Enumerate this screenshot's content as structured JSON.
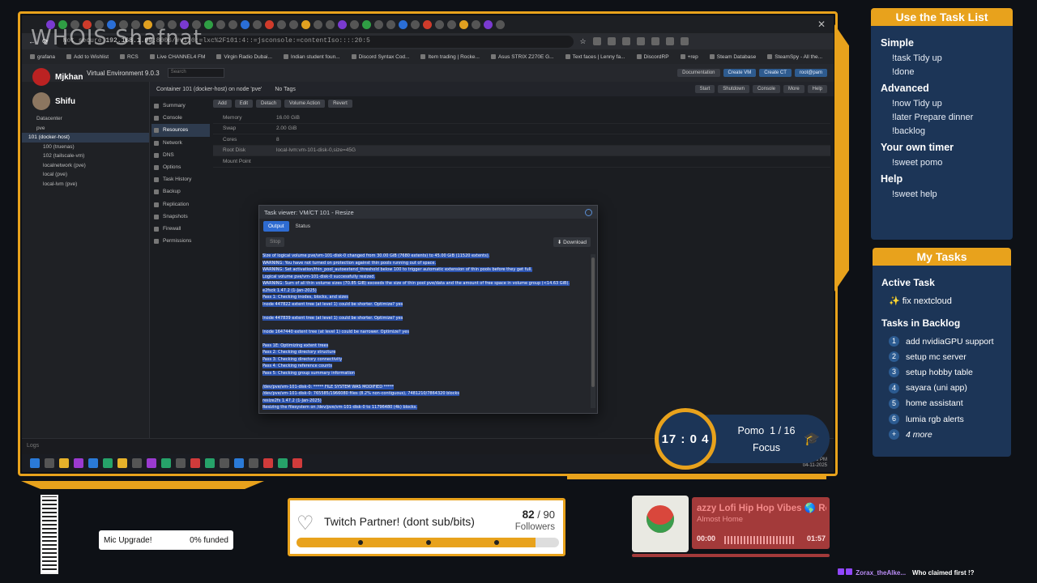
{
  "screen": {
    "address": {
      "prefix": "Not secure ",
      "host": "192.168.1.99",
      "rest": ":8006/#v1:0:=lxc%2F101:4::=jsconsole:=contentIso::::20:5"
    },
    "bookmarks": [
      "grafana",
      "Add to Wishlist",
      "RCS",
      "Live CHANNEL4 FM",
      "Virgin Radio Dubai...",
      "Indian student foun...",
      "Discord Syntax Cod...",
      "Item trading | Rocke...",
      "Asus STRIX Z270E G...",
      "Text faces | Lenny fa...",
      "DiscordRP",
      "+rep",
      "Steam Database",
      "SteamSpy - All the..."
    ],
    "pve": {
      "title": "Virtual Environment 9.0.3",
      "search_placeholder": "Search",
      "top_buttons": [
        "Documentation",
        "Create VM",
        "Create CT",
        "root@pam"
      ],
      "tree": [
        "Datacenter",
        "pve",
        "101 (docker-host)",
        "100 (truenas)",
        "102 (tailscale-vm)",
        "localnetwork (pve)",
        "local (pve)",
        "local-lvm (pve)"
      ],
      "container_title": "Container 101 (docker-host) on node 'pve'",
      "tags": "No Tags",
      "ct_buttons": [
        "Start",
        "Shutdown",
        "Console",
        "More",
        "Help"
      ],
      "menu": [
        "Summary",
        "Console",
        "Resources",
        "Network",
        "DNS",
        "Options",
        "Task History",
        "Backup",
        "Replication",
        "Snapshots",
        "Firewall",
        "Permissions"
      ],
      "toolbar": [
        "Add",
        "Edit",
        "Detach",
        "Volume Action",
        "Revert"
      ],
      "resources": [
        {
          "k": "Memory",
          "v": "16.00 GiB"
        },
        {
          "k": "Swap",
          "v": "2.00 GiB"
        },
        {
          "k": "Cores",
          "v": "8"
        },
        {
          "k": "Root Disk",
          "v": "local-lvm:vm-101-disk-0,size=45G"
        },
        {
          "k": "Mount Point",
          "v": ""
        }
      ],
      "log_label": "Logs"
    },
    "dialog": {
      "title": "Task viewer: VM/CT 101 - Resize",
      "tabs": [
        "Output",
        "Status"
      ],
      "stop": "Stop",
      "download": "Download",
      "lines": [
        "  Size of logical volume pve/vm-101-disk-0 changed from 30.00 GiB (7680 extents) to 45.00 GiB (11520 extents).",
        "  WARNING: You have not turned on protection against thin pools running out of space.",
        "  WARNING: Set activation/thin_pool_autoextend_threshold below 100 to trigger automatic extension of thin pools before they get full.",
        "  Logical volume pve/vm-101-disk-0 successfully resized.",
        "  WARNING: Sum of all thin volume sizes (70.85 GiB) exceeds the size of thin pool pve/data and the amount of free space in volume group (<14.63 GiB).",
        "e2fsck 1.47.2 (1-Jan-2025)",
        "Pass 1: Checking inodes, blocks, and sizes",
        "Inode 447822 extent tree (at level 1) could be shorter.  Optimize? yes",
        "",
        "Inode 447839 extent tree (at level 1) could be shorter.  Optimize? yes",
        "",
        "Inode 1647440 extent tree (at level 1) could be narrower.  Optimize? yes",
        "",
        "Pass 1E: Optimizing extent trees",
        "Pass 2: Checking directory structure",
        "Pass 3: Checking directory connectivity",
        "Pass 4: Checking reference counts",
        "Pass 5: Checking group summary information",
        "",
        "/dev/pve/vm-101-disk-0: ***** FILE SYSTEM WAS MODIFIED *****",
        "/dev/pve/vm-101-disk-0: 765585/1966080 files (8.2% non-contiguous), 7481210/7864320 blocks",
        "resize2fs 1.47.2 (1-Jan-2025)",
        "Resizing the filesystem on /dev/pve/vm-101-disk-0 to 11796480 (4k) blocks.",
        "The filesystem on /dev/pve/vm-101-disk-0 is now 11796480 (4k) blocks long."
      ]
    },
    "taskbar_clock": {
      "time": "05:23 PM",
      "date": "04-11-2025"
    }
  },
  "overlay": {
    "watermark": "WHOIS Shafnat",
    "users": [
      "Mjkhan",
      "Shifu"
    ]
  },
  "help_panel": {
    "title": "Use the Task List",
    "sections": [
      {
        "heading": "Simple",
        "cmds": [
          "!task Tidy up",
          "!done"
        ]
      },
      {
        "heading": "Advanced",
        "cmds": [
          "!now Tidy up",
          "!later Prepare dinner",
          "!backlog"
        ]
      },
      {
        "heading": "Your own timer",
        "cmds": [
          "!sweet pomo"
        ]
      },
      {
        "heading": "Help",
        "cmds": [
          "!sweet help"
        ]
      }
    ]
  },
  "tasks_panel": {
    "title": "My Tasks",
    "active_heading": "Active Task",
    "active_task": "✨ fix nextcloud",
    "backlog_heading": "Tasks in Backlog",
    "backlog": [
      "add nvidiaGPU support",
      "setup mc server",
      "setup hobby table",
      "sayara (uni app)",
      "home assistant",
      "lumia rgb alerts"
    ],
    "more": "4 more"
  },
  "pomo": {
    "time": "17 : 0 4",
    "label": "Pomo",
    "current": "1",
    "sep": " / ",
    "total": "16",
    "state": "Focus"
  },
  "mic": {
    "label": "Mic Upgrade!",
    "funded": "0% funded"
  },
  "partner": {
    "label": "Twitch Partner! (dont sub/bits)",
    "current": "82",
    "sep": " / ",
    "target": "90",
    "unit": "Followers",
    "progress": 0.911
  },
  "music": {
    "title": "azzy Lofi Hip Hop Vibes 🌎 Ro",
    "artist": "Almost Home",
    "elapsed": "00:00",
    "duration": "01:57"
  },
  "chat": {
    "user": "Zorax_theAlke...",
    "message": "Who claimed first !?"
  },
  "colors": {
    "accent": "#e8a21c",
    "panel": "#1c3557",
    "highlight": "#2b53b0"
  }
}
